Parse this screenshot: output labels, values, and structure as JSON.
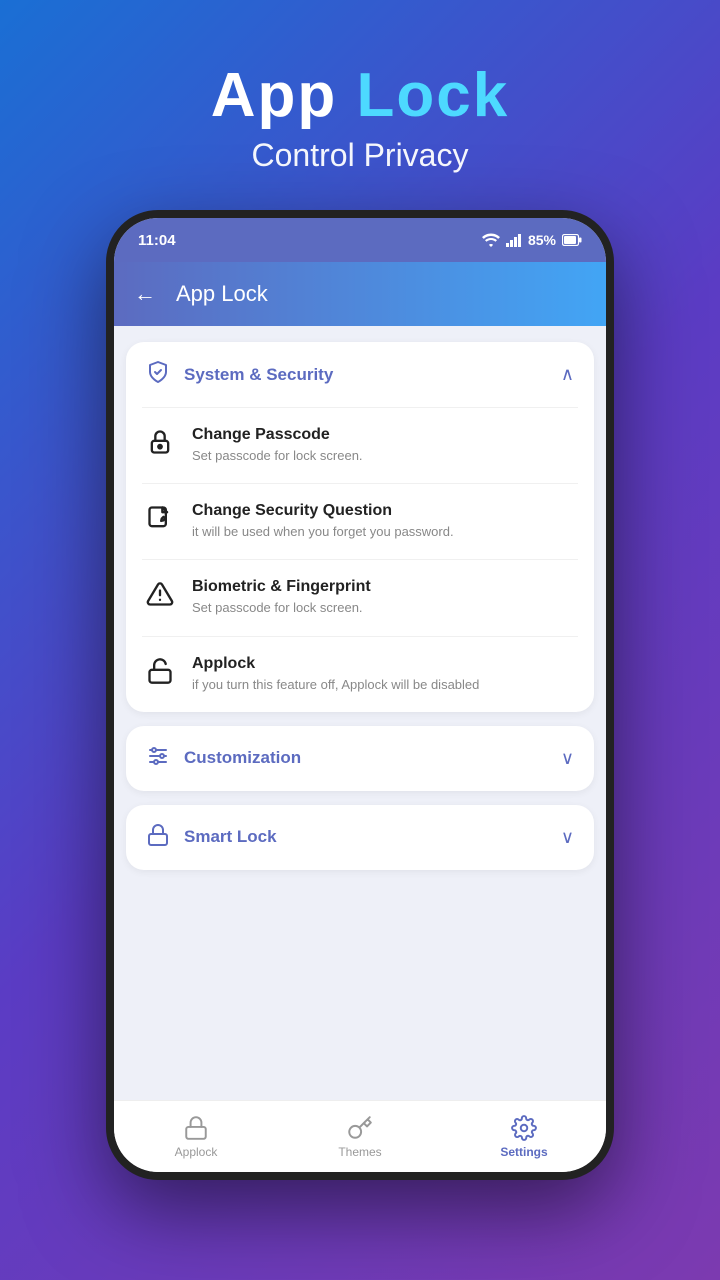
{
  "header": {
    "app_name_part1": "App ",
    "app_name_part2": "Lock",
    "subtitle": "Control Privacy"
  },
  "status_bar": {
    "time": "11:04",
    "battery": "85%"
  },
  "app_bar": {
    "title": "App Lock"
  },
  "sections": [
    {
      "id": "system_security",
      "icon": "shield",
      "title": "System & Security",
      "expanded": true,
      "chevron": "up",
      "items": [
        {
          "id": "change_passcode",
          "icon": "lock-key",
          "title": "Change Passcode",
          "subtitle": "Set passcode for lock screen."
        },
        {
          "id": "change_security_question",
          "icon": "edit",
          "title": "Change Security Question",
          "subtitle": "it will be used when you forget you password."
        },
        {
          "id": "biometric",
          "icon": "triangle-alert",
          "title": "Biometric & Fingerprint",
          "subtitle": "Set passcode for lock screen."
        },
        {
          "id": "applock",
          "icon": "unlock",
          "title": "Applock",
          "subtitle": "if you turn this feature off, Applock will be disabled"
        }
      ]
    },
    {
      "id": "customization",
      "icon": "sliders",
      "title": "Customization",
      "expanded": false,
      "chevron": "down",
      "items": []
    },
    {
      "id": "smart_lock",
      "icon": "smart-lock",
      "title": "Smart Lock",
      "expanded": false,
      "chevron": "down",
      "items": []
    }
  ],
  "bottom_nav": [
    {
      "id": "applock",
      "label": "Applock",
      "icon": "lock",
      "active": false
    },
    {
      "id": "themes",
      "label": "Themes",
      "icon": "key",
      "active": false
    },
    {
      "id": "settings",
      "label": "Settings",
      "icon": "settings",
      "active": true
    }
  ]
}
